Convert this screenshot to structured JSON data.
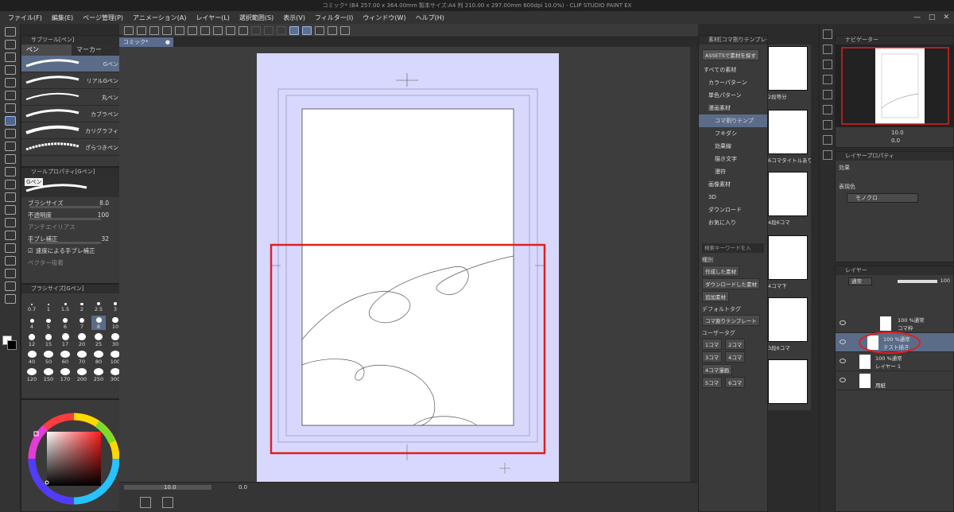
{
  "window": {
    "title": "コミック* (B4 257.00 x 364.00mm 製本サイズ:A4 判 210.00 x 297.00mm 600dpi 10.0%) - CLIP STUDIO PAINT EX"
  },
  "menu": [
    "ファイル(F)",
    "編集(E)",
    "ページ管理(P)",
    "アニメーション(A)",
    "レイヤー(L)",
    "選択範囲(S)",
    "表示(V)",
    "フィルター(I)",
    "ウィンドウ(W)",
    "ヘルプ(H)"
  ],
  "subtool": {
    "header": "サブツール[ペン]",
    "tabs": [
      "ペン",
      "マーカー"
    ],
    "brushes": [
      "Gペン",
      "リアルGペン",
      "丸ペン",
      "カブラペン",
      "カリグラフィ",
      "ざらつきペン"
    ]
  },
  "tool_property": {
    "header": "ツールプロパティ[Gペン]",
    "brush_name": "Gペン",
    "rows": [
      {
        "label": "ブラシサイズ",
        "value": "8.0"
      },
      {
        "label": "不透明度",
        "value": "100"
      },
      {
        "label": "アンチエイリアス",
        "value": ""
      },
      {
        "label": "手ブレ補正",
        "value": "32"
      },
      {
        "label": "速度による手ブレ補正",
        "value": ""
      },
      {
        "label": "ベクター吸着",
        "value": ""
      }
    ]
  },
  "brush_size": {
    "header": "ブラシサイズ[Gペン]",
    "sizes": [
      "0.7",
      "1",
      "1.5",
      "2",
      "2.5",
      "3",
      "4",
      "5",
      "6",
      "7",
      "8",
      "10",
      "12",
      "15",
      "17",
      "20",
      "25",
      "30",
      "40",
      "50",
      "60",
      "70",
      "80",
      "100",
      "120",
      "150",
      "170",
      "200",
      "250",
      "300"
    ],
    "selected": "8"
  },
  "color": {
    "main": "#ffffff",
    "sub": "#000000",
    "hue_marker": "#e8333a"
  },
  "document_tab": "コミック*",
  "status": {
    "zoom": "10.0",
    "angle": "0.0"
  },
  "material": {
    "header": "素材[コマ割りテンプレート]",
    "assets_button": "ASSETSで素材を探す",
    "tree": [
      "すべての素材",
      "カラーパターン",
      "単色パターン",
      "漫画素材",
      "コマ割りテンプ",
      "フキダシ",
      "効果線",
      "描き文字",
      "漫符",
      "画像素材",
      "3D",
      "ダウンロード",
      "お気に入り"
    ],
    "search_placeholder": "検索キーワードを入",
    "kind_label": "種別",
    "kind_buttons": [
      "作成した素材",
      "ダウンロードした素材",
      "追加素材"
    ],
    "default_tag_label": "デフォルトタグ",
    "default_tag": "コマ割りテンプレート",
    "user_tag_label": "ユーザータグ",
    "user_tags": [
      "1コマ",
      "2コマ",
      "3コマ",
      "4コマ",
      "4コマ漫画",
      "5コマ",
      "6コマ"
    ],
    "thumbnails": [
      "2段等分",
      "6コマタイトルあり",
      "4段6コマ",
      "4コマ下",
      "3段6コマ"
    ]
  },
  "navigator": {
    "header": "ナビゲーター",
    "zoom": "10.0",
    "angle": "0.0"
  },
  "layer_property": {
    "header": "レイヤープロパティ",
    "effect_label": "効果",
    "expression_label": "表現色",
    "expression_value": "モノクロ"
  },
  "layers": {
    "header": "レイヤー",
    "blend": "通常",
    "opacity": "100",
    "items": [
      {
        "line1": "100 %通常",
        "line2": "コマ枠"
      },
      {
        "line1": "100 %通常",
        "line2": "テスト描き"
      },
      {
        "line1": "100 %通常",
        "line2": "レイヤー 1"
      },
      {
        "line1": "",
        "line2": "用紙"
      }
    ]
  }
}
